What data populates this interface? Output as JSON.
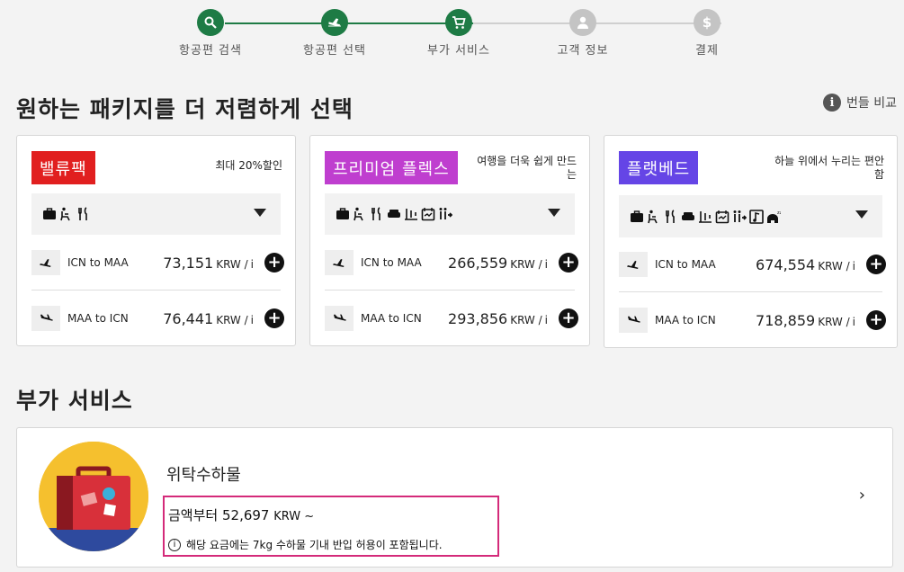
{
  "stepper": {
    "steps": [
      {
        "label": "항공편 검색",
        "icon": "search-icon"
      },
      {
        "label": "항공편 선택",
        "icon": "plane-icon"
      },
      {
        "label": "부가 서비스",
        "icon": "cart-icon"
      },
      {
        "label": "고객 정보",
        "icon": "person-icon"
      },
      {
        "label": "결제",
        "icon": "dollar-icon"
      }
    ],
    "colors": {
      "done": "#1e7b45",
      "active": "#1e7b45",
      "pending": "#c4c4c4"
    }
  },
  "packages": {
    "heading": "원하는 패키지를 더 저렴하게 선택",
    "compare_label": "번들 비교",
    "cards": [
      {
        "name": "밸류팩",
        "color": "#e11f1f",
        "tagline": "최대 20%할인",
        "routes": [
          {
            "route": "ICN to MAA",
            "price": "73,151",
            "currency": "KRW /"
          },
          {
            "route": "MAA to ICN",
            "price": "76,441",
            "currency": "KRW /"
          }
        ]
      },
      {
        "name": "프리미엄 플렉스",
        "color": "#bf3ecf",
        "tagline": "여행을 더욱 쉽게 만드는",
        "routes": [
          {
            "route": "ICN to MAA",
            "price": "266,559",
            "currency": "KRW /"
          },
          {
            "route": "MAA to ICN",
            "price": "293,856",
            "currency": "KRW /"
          }
        ]
      },
      {
        "name": "플랫베드",
        "color": "#6545e6",
        "tagline": "하늘 위에서 누리는 편안함",
        "routes": [
          {
            "route": "ICN to MAA",
            "price": "674,554",
            "currency": "KRW /"
          },
          {
            "route": "MAA to ICN",
            "price": "718,859",
            "currency": "KRW /"
          }
        ]
      }
    ]
  },
  "addons": {
    "title": "부가 서비스",
    "item": {
      "name": "위탁수하물",
      "price_prefix": "금액부터",
      "price": "52,697",
      "currency": "KRW ~",
      "note": "해당 요금에는 7kg 수하물 기내 반입 허용이 포함됩니다."
    }
  }
}
